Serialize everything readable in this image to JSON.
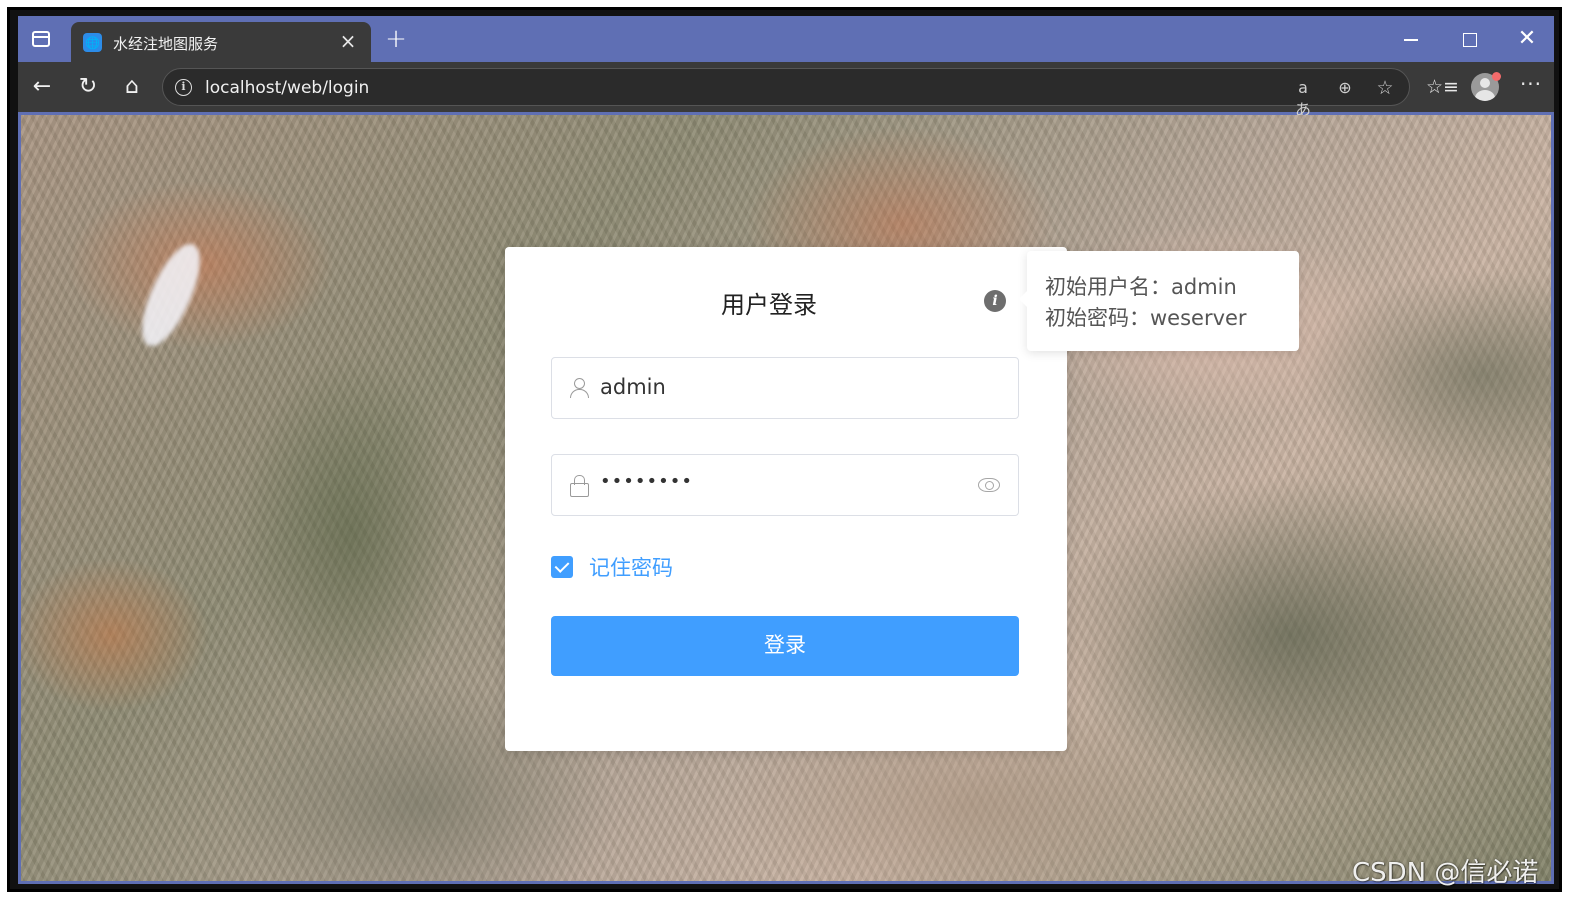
{
  "browser": {
    "tab_title": "水经注地图服务",
    "url": "localhost/web/login",
    "omnibox_translate_glyph": "aあ"
  },
  "login": {
    "title": "用户登录",
    "username_value": "admin",
    "password_masked": "••••••••",
    "remember_label": "记住密码",
    "remember_checked": true,
    "submit_label": "登录",
    "accent_color": "#409eff"
  },
  "tooltip": {
    "line1": "初始用户名：admin",
    "line2": "初始密码：weserver"
  },
  "watermark": "CSDN @信必诺",
  "icons": [
    "tab-actions-icon",
    "favicon-globe-icon",
    "tab-close-icon",
    "new-tab-icon",
    "minimize-icon",
    "maximize-icon",
    "window-close-icon",
    "back-icon",
    "reload-icon",
    "home-icon",
    "site-info-icon",
    "translate-icon",
    "zoom-icon",
    "favorite-star-icon",
    "favorites-list-icon",
    "profile-avatar",
    "more-icon",
    "info-hint-icon",
    "user-icon",
    "lock-icon",
    "eye-icon",
    "checkbox-checked-icon"
  ]
}
